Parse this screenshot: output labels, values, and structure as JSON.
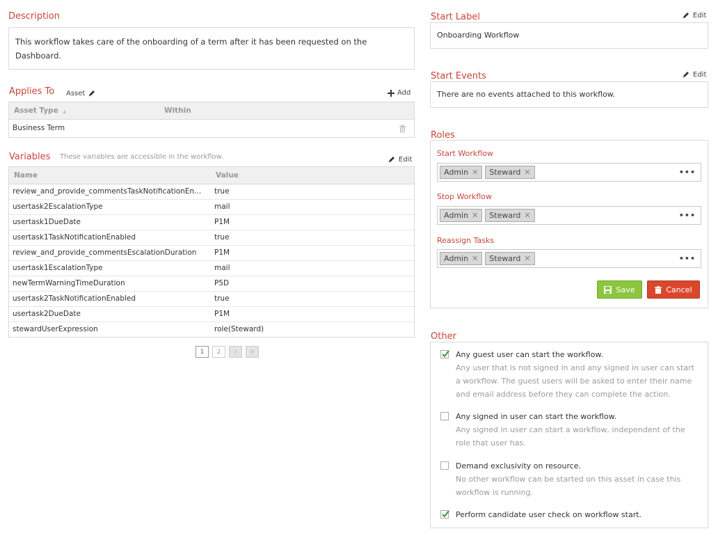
{
  "description": {
    "title": "Description",
    "text": "This workflow takes care of the onboarding of a term after it has been requested on the Dashboard."
  },
  "applies_to": {
    "title": "Applies To",
    "asset_label": "Asset",
    "add_label": "Add",
    "columns": [
      "Asset Type",
      "Within"
    ],
    "sort_indicator": "▲",
    "rows": [
      {
        "asset_type": "Business Term",
        "within": ""
      }
    ]
  },
  "variables": {
    "title": "Variables",
    "hint": "These variables are accessible in the workflow.",
    "edit_label": "Edit",
    "columns": [
      "Name",
      "Value"
    ],
    "rows": [
      {
        "name": "review_and_provide_commentsTaskNotificationEn...",
        "value": "true"
      },
      {
        "name": "usertask2EscalationType",
        "value": "mail"
      },
      {
        "name": "usertask1DueDate",
        "value": "P1M"
      },
      {
        "name": "usertask1TaskNotificationEnabled",
        "value": "true"
      },
      {
        "name": "review_and_provide_commentsEscalationDuration",
        "value": "P1M"
      },
      {
        "name": "usertask1EscalationType",
        "value": "mail"
      },
      {
        "name": "newTermWarningTimeDuration",
        "value": "P5D"
      },
      {
        "name": "usertask2TaskNotificationEnabled",
        "value": "true"
      },
      {
        "name": "usertask2DueDate",
        "value": "P1M"
      },
      {
        "name": "stewardUserExpression",
        "value": "role(Steward)"
      }
    ],
    "pager": {
      "pages": [
        "1",
        "2"
      ],
      "current": "1",
      "next": "›",
      "last": "»"
    }
  },
  "start_label": {
    "title": "Start Label",
    "edit_label": "Edit",
    "value": "Onboarding Workflow"
  },
  "start_events": {
    "title": "Start Events",
    "edit_label": "Edit",
    "value": "There are no events attached to this workflow."
  },
  "roles": {
    "title": "Roles",
    "groups": [
      {
        "label": "Start Workflow",
        "tags": [
          "Admin",
          "Steward"
        ]
      },
      {
        "label": "Stop Workflow",
        "tags": [
          "Admin",
          "Steward"
        ]
      },
      {
        "label": "Reassign Tasks",
        "tags": [
          "Admin",
          "Steward"
        ]
      }
    ],
    "tag_remove": "✕",
    "more": "•••",
    "save_label": "Save",
    "cancel_label": "Cancel",
    "save_color": "#8cc63f",
    "cancel_color": "#d9472d"
  },
  "other": {
    "title": "Other",
    "options": [
      {
        "checked": true,
        "title": "Any guest user can start the workflow.",
        "desc": "Any user that is not signed in and any signed in user can start a workflow. The guest users will be asked to enter their name and email address before they can complete the action."
      },
      {
        "checked": false,
        "title": "Any signed in user can start the workflow.",
        "desc": "Any signed in user can start a workflow, independent of the role that user has."
      },
      {
        "checked": false,
        "title": "Demand exclusivity on resource.",
        "desc": "No other workflow can be started on this asset in case this workflow is running."
      },
      {
        "checked": true,
        "title": "Perform candidate user check on workflow start.",
        "desc": ""
      }
    ]
  },
  "colors": {
    "accent": "#c9453a",
    "check": "#3a9a3a"
  }
}
